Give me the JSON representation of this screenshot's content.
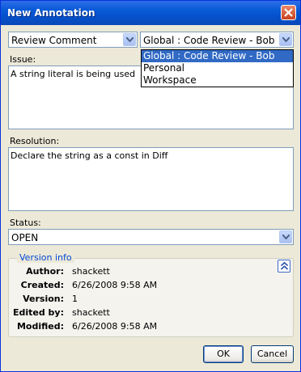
{
  "window": {
    "title": "New Annotation"
  },
  "type_combo": {
    "value": "Review Comment"
  },
  "scope_combo": {
    "value": "Global : Code Review - Bob",
    "options": [
      "Global : Code Review - Bob",
      "Personal",
      "Workspace"
    ]
  },
  "issue": {
    "label": "Issue:",
    "text": "A string literal is being used"
  },
  "resolution": {
    "label": "Resolution:",
    "text": "Declare the string as a const in Diff"
  },
  "status": {
    "label": "Status:",
    "value": "OPEN"
  },
  "version_info": {
    "legend": "Version info",
    "rows": [
      {
        "key": "Author:",
        "value": "shackett"
      },
      {
        "key": "Created:",
        "value": "6/26/2008 9:58 AM"
      },
      {
        "key": "Version:",
        "value": "1"
      },
      {
        "key": "Edited by:",
        "value": "shackett"
      },
      {
        "key": "Modified:",
        "value": "6/26/2008 9:58 AM"
      }
    ]
  },
  "buttons": {
    "ok": "OK",
    "cancel": "Cancel"
  }
}
